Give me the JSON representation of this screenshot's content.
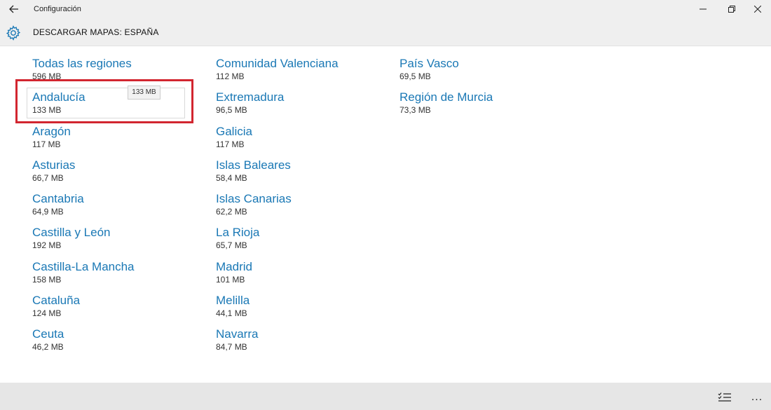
{
  "titlebar": {
    "app_title": "Configuración",
    "back_icon": "arrow-left-icon",
    "minimize_icon": "minimize-icon",
    "restore_icon": "restore-icon",
    "close_icon": "close-icon"
  },
  "header": {
    "icon": "gear-icon",
    "title": "DESCARGAR MAPAS: ESPAÑA",
    "accent_color": "#1a78b5"
  },
  "columns": [
    [
      {
        "name": "Todas las regiones",
        "size": "596 MB"
      },
      {
        "name": "Andalucía",
        "size": "133 MB"
      },
      {
        "name": "Aragón",
        "size": "117 MB"
      },
      {
        "name": "Asturias",
        "size": "66,7 MB"
      },
      {
        "name": "Cantabria",
        "size": "64,9 MB"
      },
      {
        "name": "Castilla y León",
        "size": "192 MB"
      },
      {
        "name": "Castilla-La Mancha",
        "size": "158 MB"
      },
      {
        "name": "Cataluña",
        "size": "124 MB"
      },
      {
        "name": "Ceuta",
        "size": "46,2 MB"
      }
    ],
    [
      {
        "name": "Comunidad Valenciana",
        "size": "112 MB"
      },
      {
        "name": "Extremadura",
        "size": "96,5 MB"
      },
      {
        "name": "Galicia",
        "size": "117 MB"
      },
      {
        "name": "Islas Baleares",
        "size": "58,4 MB"
      },
      {
        "name": "Islas Canarias",
        "size": "62,2 MB"
      },
      {
        "name": "La Rioja",
        "size": "65,7 MB"
      },
      {
        "name": "Madrid",
        "size": "101 MB"
      },
      {
        "name": "Melilla",
        "size": "44,1 MB"
      },
      {
        "name": "Navarra",
        "size": "84,7 MB"
      }
    ],
    [
      {
        "name": "País Vasco",
        "size": "69,5 MB"
      },
      {
        "name": "Región de Murcia",
        "size": "73,3 MB"
      }
    ]
  ],
  "tooltip": {
    "text": "133 MB"
  },
  "highlight_color": "#d22630",
  "appbar": {
    "select_icon": "checklist-icon",
    "more_label": "..."
  }
}
